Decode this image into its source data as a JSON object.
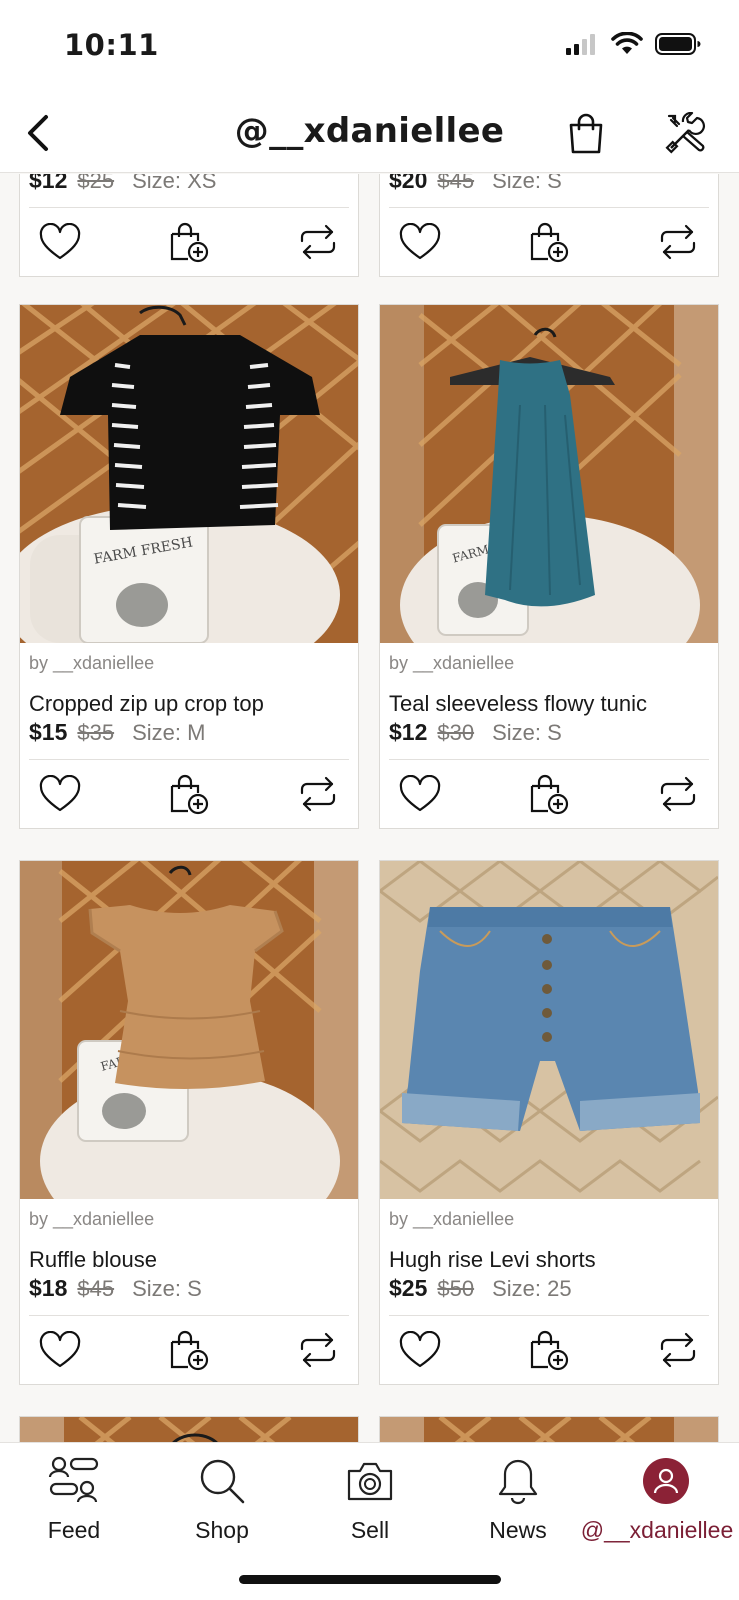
{
  "status": {
    "time": "10:11"
  },
  "header": {
    "title": "@__xdaniellee"
  },
  "top_partial": [
    {
      "price": "$12",
      "orig_price": "$25",
      "size": "Size: XS"
    },
    {
      "price": "$20",
      "orig_price": "$45",
      "size": "Size: S"
    }
  ],
  "listings": [
    {
      "by": "by __xdaniellee",
      "title": "Cropped zip up crop top",
      "price": "$15",
      "orig_price": "$35",
      "size": "Size: M"
    },
    {
      "by": "by __xdaniellee",
      "title": "Teal sleeveless flowy tunic",
      "price": "$12",
      "orig_price": "$30",
      "size": "Size: S"
    },
    {
      "by": "by __xdaniellee",
      "title": "Ruffle blouse",
      "price": "$18",
      "orig_price": "$45",
      "size": "Size: S"
    },
    {
      "by": "by __xdaniellee",
      "title": "Hugh rise Levi shorts",
      "price": "$25",
      "orig_price": "$50",
      "size": "Size: 25"
    }
  ],
  "tabs": [
    {
      "label": "Feed",
      "icon": "feed-icon"
    },
    {
      "label": "Shop",
      "icon": "search-icon"
    },
    {
      "label": "Sell",
      "icon": "camera-icon"
    },
    {
      "label": "News",
      "icon": "bell-icon"
    },
    {
      "label": "@__xdaniellee",
      "icon": "avatar-icon",
      "active": true
    }
  ],
  "colors": {
    "accent": "#8b2236",
    "text": "#1a1a1a",
    "muted": "#8a8785"
  }
}
